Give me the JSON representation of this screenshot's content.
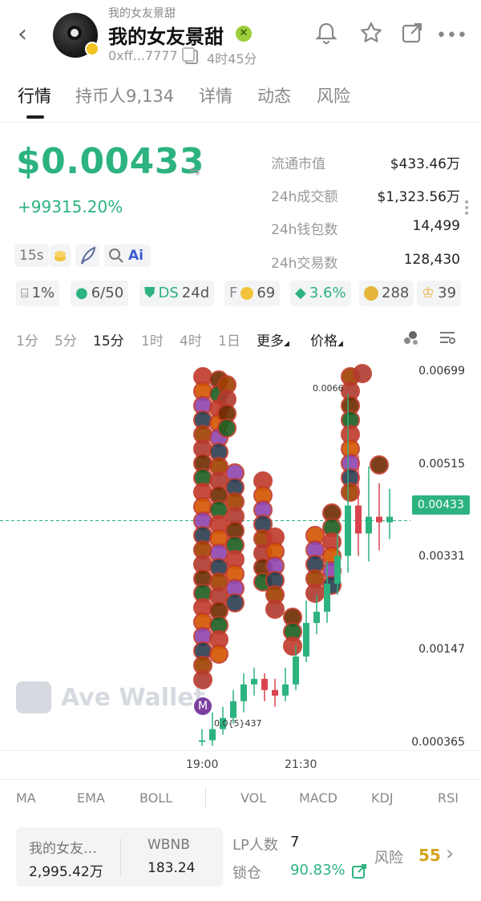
{
  "header": {
    "subtitle": "我的女友景甜",
    "title": "我的女友景甜",
    "address": "0xff...7777",
    "age": "4时45分"
  },
  "tabs": [
    {
      "label": "行情"
    },
    {
      "label": "持币人9,134"
    },
    {
      "label": "详情"
    },
    {
      "label": "动态"
    },
    {
      "label": "风险"
    }
  ],
  "price": {
    "value": "$0.00433",
    "change": "+99315.20%"
  },
  "stats": [
    {
      "label": "流通市值",
      "value": "$433.46万"
    },
    {
      "label": "24h成交额",
      "value": "$1,323.56万"
    },
    {
      "label": "24h钱包数",
      "value": "14,499"
    },
    {
      "label": "24h交易数",
      "value": "128,430"
    }
  ],
  "chips_row1": {
    "interval": "15s",
    "ai": "Ai"
  },
  "chips_row2": {
    "gift": "1%",
    "holders": "6/50",
    "ds_prefix": "DS",
    "ds": "24d",
    "f_prefix": "F",
    "f": "69",
    "layers": "3.6%",
    "bag": "288",
    "trophy": "39"
  },
  "timeframes": [
    "1分",
    "5分",
    "15分",
    "1时",
    "4时",
    "1日",
    "更多",
    "价格"
  ],
  "active_timeframe": "15分",
  "chart": {
    "y_ticks": [
      "0.00699",
      "0.00515",
      "0.00331",
      "0.00147",
      "0.000365"
    ],
    "current": "0.00433",
    "peak_label": "0.0066",
    "low_label": "0.0{5}437",
    "x_ticks": [
      "19:00",
      "21:30"
    ],
    "watermark": "Ave Wallet",
    "marker": "M"
  },
  "chart_data": {
    "type": "candlestick",
    "y_ticks": [
      0.00699,
      0.00515,
      0.00331,
      0.00147,
      0.000365
    ],
    "x_ticks": [
      "19:00",
      "21:30"
    ],
    "current_price": 0.00433,
    "candles": [
      {
        "o": 0.0004,
        "c": 0.0004,
        "h": 0.0006,
        "l": 0.0003
      },
      {
        "o": 0.0004,
        "c": 0.0006,
        "h": 0.0009,
        "l": 0.0003
      },
      {
        "o": 0.0006,
        "c": 0.0008,
        "h": 0.001,
        "l": 0.0005
      },
      {
        "o": 0.0008,
        "c": 0.0011,
        "h": 0.0013,
        "l": 0.0007
      },
      {
        "o": 0.0011,
        "c": 0.0014,
        "h": 0.0016,
        "l": 0.0009
      },
      {
        "o": 0.0014,
        "c": 0.0015,
        "h": 0.0017,
        "l": 0.0012
      },
      {
        "o": 0.0015,
        "c": 0.0013,
        "h": 0.0016,
        "l": 0.0011
      },
      {
        "o": 0.0013,
        "c": 0.0012,
        "h": 0.0015,
        "l": 0.001
      },
      {
        "o": 0.0012,
        "c": 0.0014,
        "h": 0.0017,
        "l": 0.0011
      },
      {
        "o": 0.0014,
        "c": 0.0019,
        "h": 0.0021,
        "l": 0.0013
      },
      {
        "o": 0.0019,
        "c": 0.0025,
        "h": 0.0029,
        "l": 0.0018
      },
      {
        "o": 0.0025,
        "c": 0.0027,
        "h": 0.003,
        "l": 0.0023
      },
      {
        "o": 0.0027,
        "c": 0.0032,
        "h": 0.0036,
        "l": 0.0025
      },
      {
        "o": 0.0032,
        "c": 0.0037,
        "h": 0.0041,
        "l": 0.003
      },
      {
        "o": 0.0037,
        "c": 0.0046,
        "h": 0.0066,
        "l": 0.0034
      },
      {
        "o": 0.0046,
        "c": 0.0041,
        "h": 0.0055,
        "l": 0.0037
      },
      {
        "o": 0.0041,
        "c": 0.0044,
        "h": 0.0053,
        "l": 0.0036
      },
      {
        "o": 0.0044,
        "c": 0.0043,
        "h": 0.005,
        "l": 0.0038
      },
      {
        "o": 0.0043,
        "c": 0.0044,
        "h": 0.0049,
        "l": 0.004
      }
    ]
  },
  "indicators": [
    "MA",
    "EMA",
    "BOLL",
    "VOL",
    "MACD",
    "KDJ",
    "RSI"
  ],
  "pool": {
    "token_name": "我的女友…",
    "token_amount": "2,995.42万",
    "base_name": "WBNB",
    "base_amount": "183.24"
  },
  "lp": {
    "label": "LP人数",
    "value": "7",
    "lock_label": "锁仓",
    "lock_value": "90.83%"
  },
  "risk": {
    "label": "风险",
    "value": "55"
  },
  "colors": {
    "up": "#2cb37f",
    "down": "#d9434e",
    "risk": "#d4a21a"
  }
}
